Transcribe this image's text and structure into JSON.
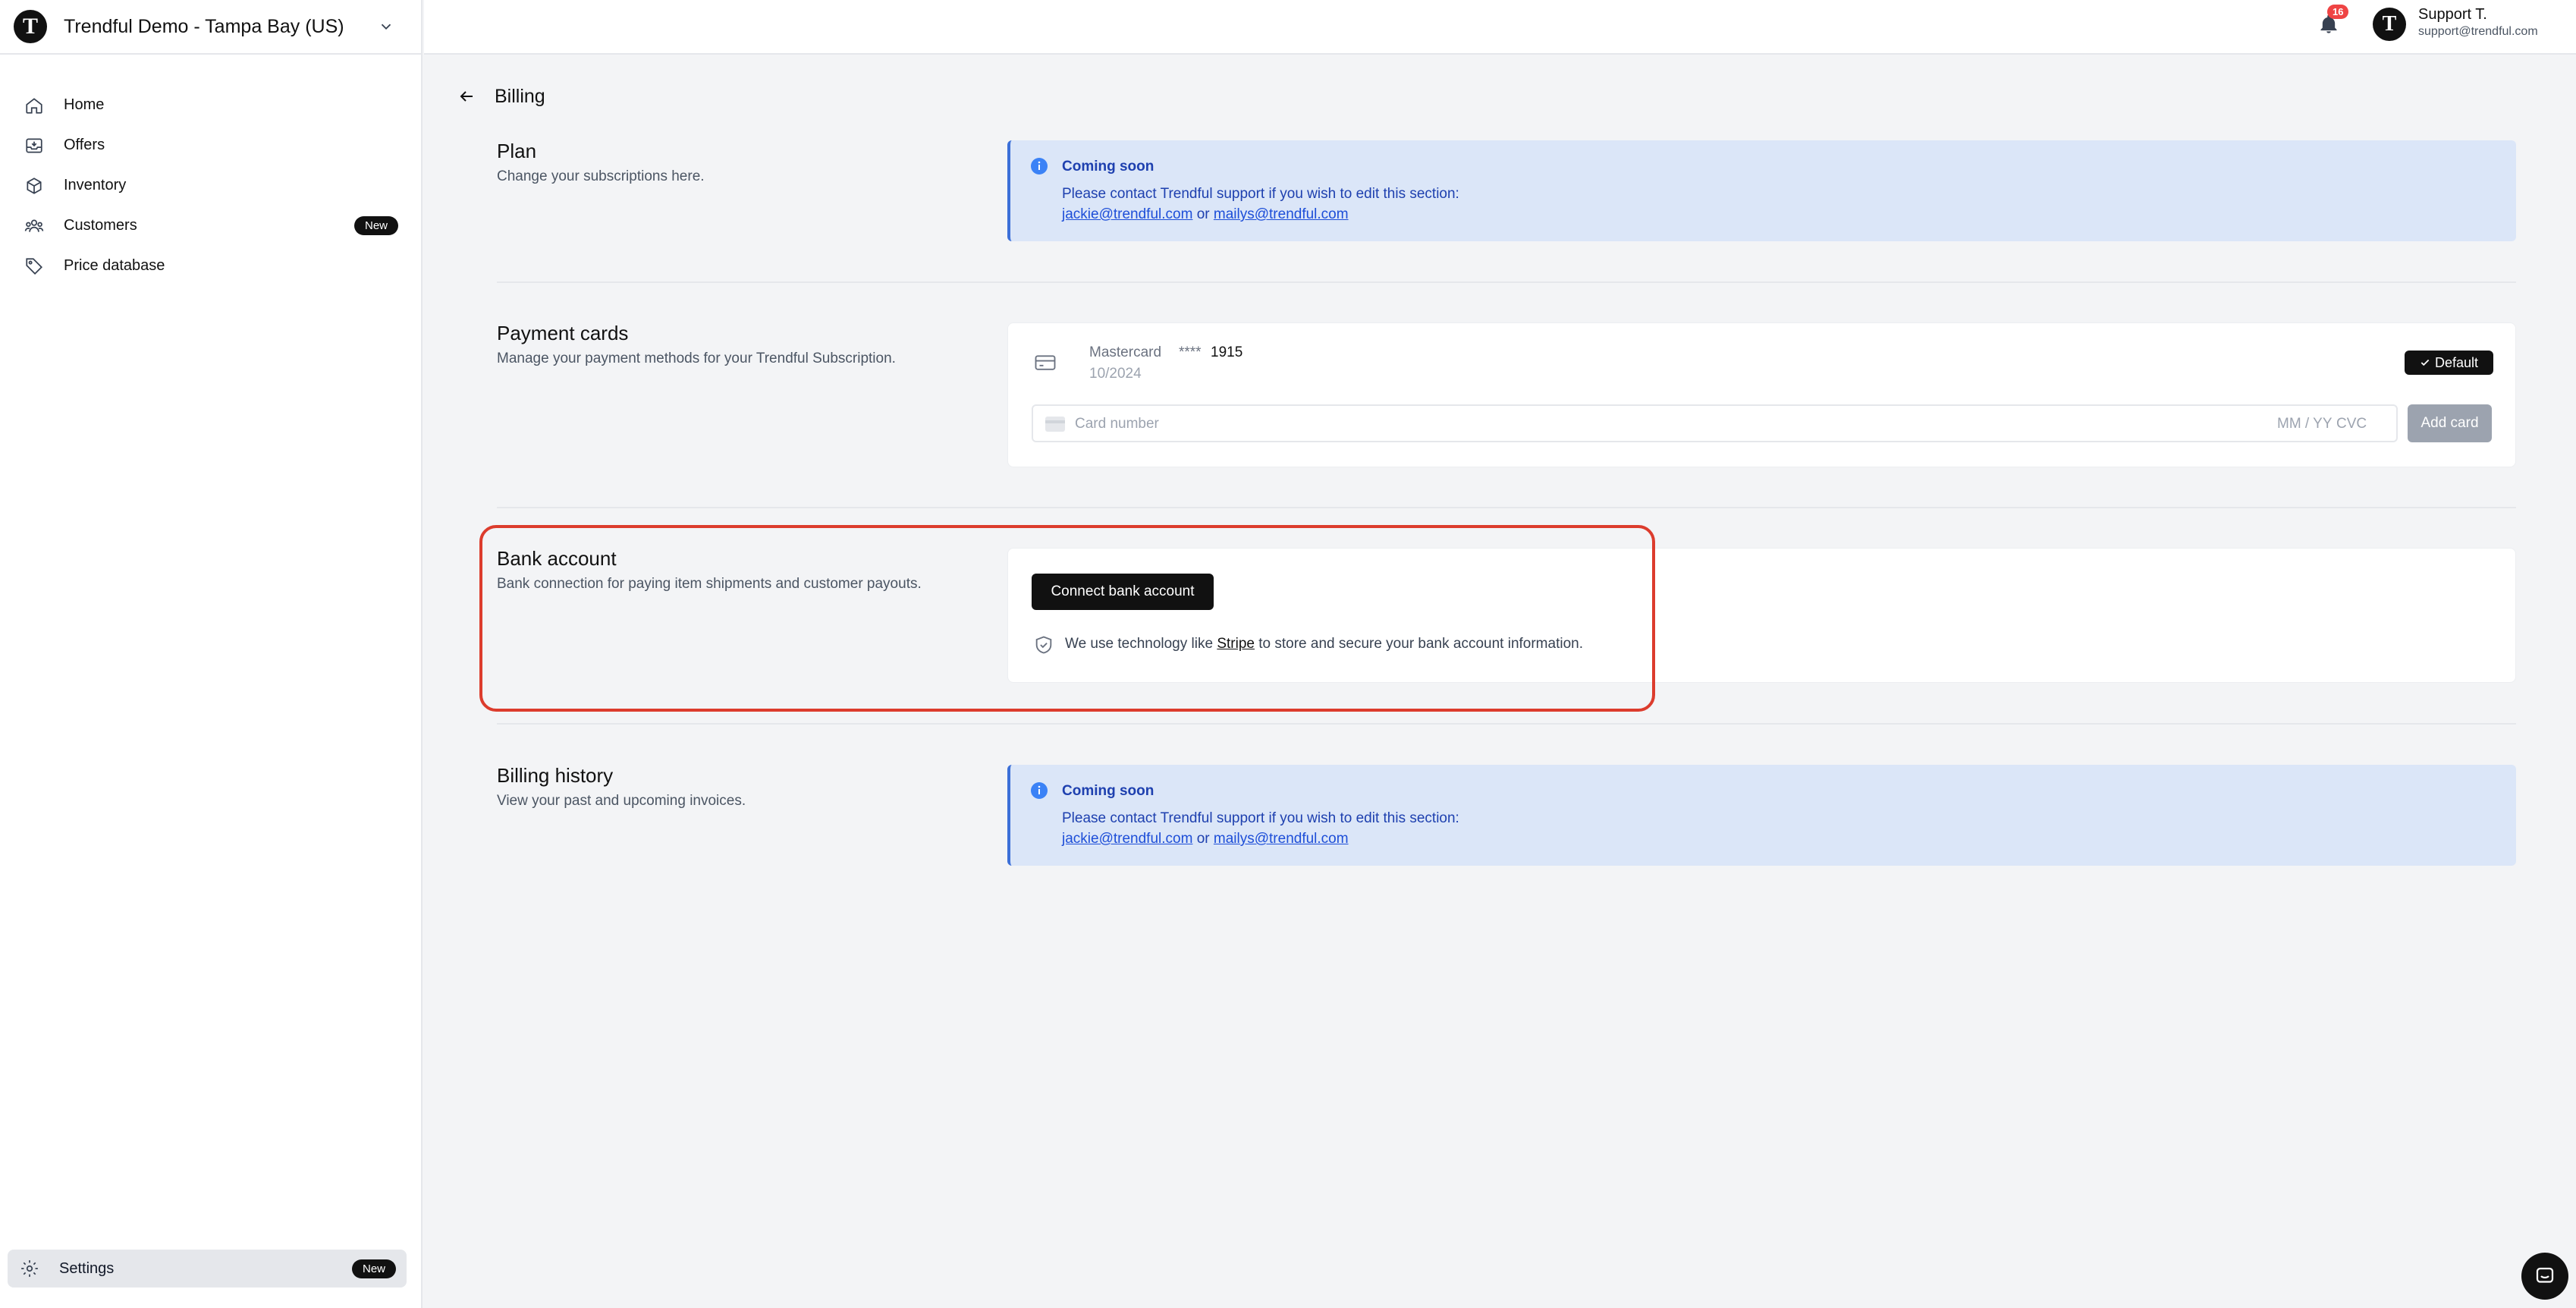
{
  "org": {
    "logo_letter": "T",
    "name": "Trendful Demo - Tampa Bay (US)"
  },
  "sidebar": {
    "items": [
      {
        "label": "Home",
        "icon": "home-icon"
      },
      {
        "label": "Offers",
        "icon": "inbox-icon"
      },
      {
        "label": "Inventory",
        "icon": "box-icon"
      },
      {
        "label": "Customers",
        "icon": "users-icon",
        "badge": "New"
      },
      {
        "label": "Price database",
        "icon": "tag-icon"
      }
    ],
    "settings": {
      "label": "Settings",
      "icon": "gear-icon",
      "badge": "New"
    }
  },
  "topbar": {
    "notifications_count": "16",
    "user": {
      "avatar_letter": "T",
      "name": "Support T.",
      "email": "support@trendful.com"
    }
  },
  "page": {
    "title": "Billing"
  },
  "plan": {
    "title": "Plan",
    "description": "Change your subscriptions here.",
    "info": {
      "title": "Coming soon",
      "text": "Please contact Trendful support if you wish to edit this section:",
      "link1": "jackie@trendful.com",
      "or": "or",
      "link2": "mailys@trendful.com"
    }
  },
  "payment_cards": {
    "title": "Payment cards",
    "description": "Manage your payment methods for your Trendful Subscription.",
    "card": {
      "brand": "Mastercard",
      "stars": "****",
      "last4": "1915",
      "expiry": "10/2024",
      "default_label": "Default"
    },
    "input": {
      "placeholder": "Card number",
      "mmyy": "MM / YY",
      "cvc": "CVC"
    },
    "add_button": "Add card"
  },
  "bank_account": {
    "title": "Bank account",
    "description": "Bank connection for paying item shipments and customer payouts.",
    "connect_button": "Connect bank account",
    "secure_prefix": "We use technology like",
    "secure_link": "Stripe",
    "secure_suffix": "to store and secure your bank account information."
  },
  "billing_history": {
    "title": "Billing history",
    "description": "View your past and upcoming invoices.",
    "info": {
      "title": "Coming soon",
      "text": "Please contact Trendful support if you wish to edit this section:",
      "link1": "jackie@trendful.com",
      "or": "or",
      "link2": "mailys@trendful.com"
    }
  },
  "colors": {
    "accent": "#111111",
    "info_bg": "#dbe6f8",
    "info_text": "#1e40af",
    "highlight": "#dc3c2d",
    "notification": "#ef4444"
  }
}
